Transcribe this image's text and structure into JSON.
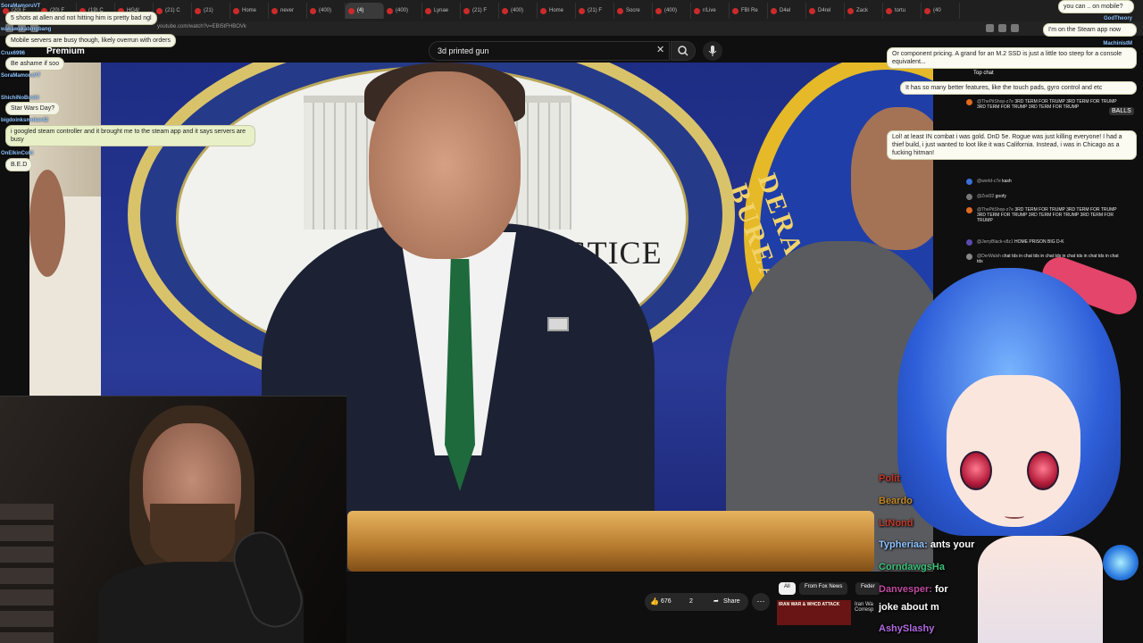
{
  "browser": {
    "tabs": [
      "(20) F",
      "(20) F",
      "(19) C",
      "HG4/",
      "(21) C",
      "(21)",
      "Home",
      "never",
      "(400)",
      "(4)",
      "(400)",
      "Lynae",
      "(21) F",
      "(400)",
      "Home",
      "(21) F",
      "Socre",
      "(400)",
      "r/Live",
      "FBI Re",
      "D4el",
      "D4rel",
      "Zack",
      "tortu",
      "(40"
    ],
    "active_tab_index": 9,
    "url": "youtube.com/watch?v=EBI5tFHBOVk"
  },
  "youtube": {
    "premium_label": "Premium",
    "search_value": "3d printed gun",
    "like_count": "676",
    "dislike_count": "2",
    "share_label": "Share",
    "chips": [
      "All",
      "From Fox News",
      "Feder"
    ],
    "rec_thumb_text": "IRAN WAR & WHCD ATTACK",
    "rec_title": "Iran Wa Corresp",
    "top_chat_label": "Top chat"
  },
  "video": {
    "seal_text": "DEPARTME     JSTICE",
    "fbi_text": "DERAL BUREA"
  },
  "yt_chat": [
    {
      "name": "@ThePitShop-z7e",
      "text": "3RD TERM FOR TRUMP 3RD TERM FOR TRUMP 3RD TERM FOR TRUMP 3RD TERM FOR TRUMP",
      "color": "#e06a1e"
    },
    {
      "name": "BALLS",
      "text": "",
      "color": "#d43"
    },
    {
      "name": "@world-c7e",
      "text": "kash",
      "color": "#3a6fd8"
    },
    {
      "name": "@Zod32",
      "text": "goofy",
      "color": "#777"
    },
    {
      "name": "@ThePitShop-z7e",
      "text": "3RD TERM FOR TRUMP 3RD TERM FOR TRUMP 3RD TERM FOR TRUMP 3RD TERM FOR TRUMP 3RD TERM FOR TRUMP",
      "color": "#e06a1e"
    },
    {
      "name": "@JerryBlack-v8z1",
      "text": "HOME PRISON BIG D-K",
      "color": "#5a4ab0"
    },
    {
      "name": "@DerWalsh",
      "text": "chat tds in chat tds in chat tds in chat tds in chat tds in chat tds",
      "color": "#888"
    }
  ],
  "left_chat": [
    {
      "name": "SoraMamoruVT",
      "msg": "5 shots at allen and not hitting him is pretty bad ngl"
    },
    {
      "name": "wakawakabingbang",
      "msg": "Mobile servers are busy though, likely overrun with orders"
    },
    {
      "name": "Crux6996",
      "msg": "Be ashame if soo"
    },
    {
      "name": "SoraMamoruVT",
      "msg": ""
    },
    {
      "name": "ShichiNoBushi",
      "msg": "Star Wars Day?"
    },
    {
      "name": "bigdoinksmoker42",
      "msg": "i googled steam controller and it brought me to the steam app and it says servers are busy"
    },
    {
      "name": "OnElkinCold",
      "msg": "B.E.D"
    }
  ],
  "right_chat": [
    {
      "name": "",
      "msg": "you can .. on mobile?"
    },
    {
      "name": "GodTheory",
      "msg": "I'm on the Steam app now"
    },
    {
      "name": "MachinistM",
      "msg": "Or component pricing. A grand for an M.2 SSD is just a little too steep for a console equivalent..."
    },
    {
      "name": "",
      "msg": "It has so many better features, like the touch pads, gyro control and etc"
    },
    {
      "name": "",
      "msg": "Lol! at least IN combat i was gold. DnD 5e. Rogue was just killing everyone! I had a thief build, i just wanted to loot like it was California. Instead, i was in Chicago as a fucking hitman!"
    }
  ],
  "twitch_chat": [
    {
      "name": "Polit",
      "msg": "",
      "color": "#c0392b"
    },
    {
      "name": "Beardo",
      "msg": "",
      "color": "#c0882b"
    },
    {
      "name": "LtNond",
      "msg": "",
      "color": "#c0392b"
    },
    {
      "name": "Typheriaa:",
      "msg": "ants your",
      "color": "#8ec4ff"
    },
    {
      "name": "CorndawgsHa",
      "msg": "",
      "color": "#3fc07a"
    },
    {
      "name": "Danvesper:",
      "msg": "for",
      "color": "#c04aa0"
    },
    {
      "name": "",
      "msg": "joke about m",
      "color": "#fff"
    },
    {
      "name": "AshySlashy",
      "msg": "",
      "color": "#b06ae0"
    }
  ],
  "colors": {
    "youtube_red": "#cc2a2a",
    "chat_name": "#8ec4ff"
  }
}
